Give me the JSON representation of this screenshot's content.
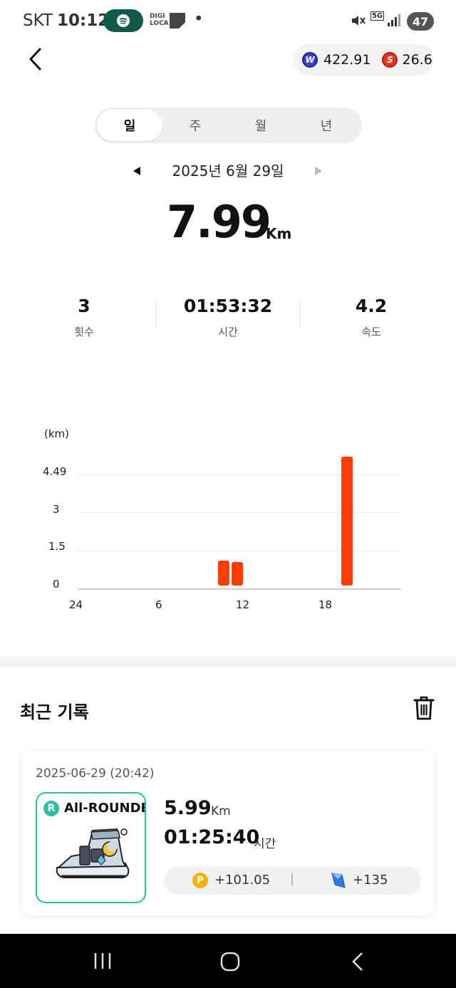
{
  "status_bar": {
    "carrier": "SKT",
    "time": "10:12",
    "digi_line1": "DIGI",
    "digi_line2": "LOCA",
    "dot": "•",
    "network": "5G",
    "battery": "47"
  },
  "wallet": {
    "w_symbol": "W",
    "w_value": "422.91",
    "s_symbol": "S",
    "s_value": "26.6"
  },
  "tabs": [
    {
      "label": "일"
    },
    {
      "label": "주"
    },
    {
      "label": "월"
    },
    {
      "label": "년"
    }
  ],
  "date": "2025년 6월 29일",
  "distance": {
    "value": "7.99",
    "unit": "Km"
  },
  "stats": [
    {
      "value": "3",
      "label": "횟수"
    },
    {
      "value": "01:53:32",
      "label": "시간"
    },
    {
      "value": "4.2",
      "label": "속도"
    }
  ],
  "chart_data": {
    "type": "bar",
    "ylabel": "(km)",
    "y_ticks": [
      "4.49",
      "3",
      "1.5",
      "0"
    ],
    "x_ticks": [
      "24",
      "6",
      "12",
      "18"
    ],
    "ylim": [
      0,
      4.49
    ],
    "x": [
      11,
      12,
      20
    ],
    "values": [
      1.0,
      0.95,
      5.2
    ],
    "color": "#ff3d00"
  },
  "recent": {
    "title": "최근 기록",
    "card": {
      "date": "2025-06-29 (20:42)",
      "shoe_badge": "R",
      "shoe_name": "All-ROUNDE",
      "distance": "5.99",
      "distance_unit": "Km",
      "time": "01:25:40",
      "time_unit": "시간",
      "reward_points": "+101.05",
      "reward_points_symbol": "P",
      "reward_divider": "|",
      "reward_tiles": "+135"
    }
  },
  "icons": {
    "back": "back-arrow-icon",
    "prev": "prev-date-icon",
    "next": "next-date-icon",
    "trash": "trash-icon",
    "spotify": "spotify-icon"
  }
}
